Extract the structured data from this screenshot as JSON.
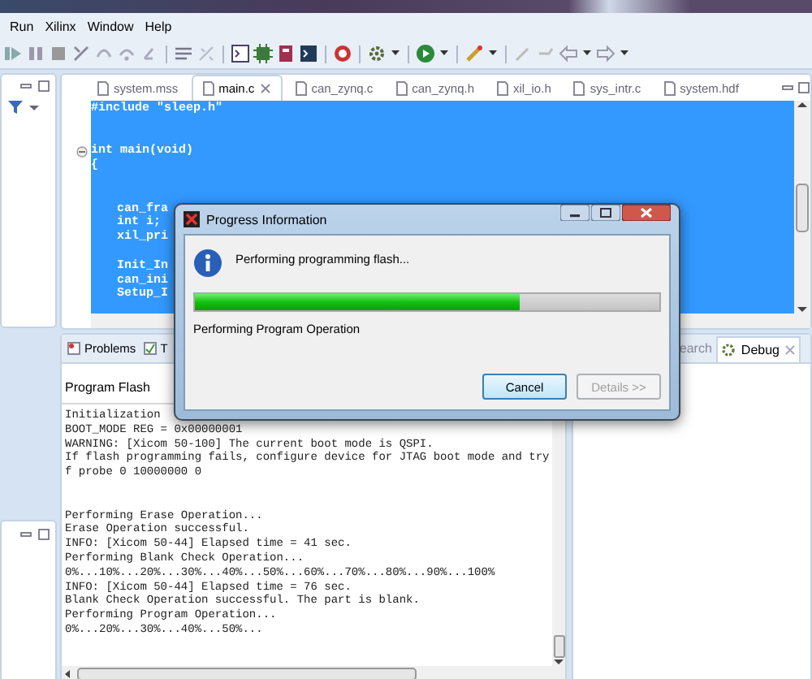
{
  "menu": [
    "Run",
    "Xilinx",
    "Window",
    "Help"
  ],
  "editor": {
    "tabs": [
      {
        "label": "system.mss",
        "selected": false
      },
      {
        "label": "main.c",
        "selected": true
      },
      {
        "label": "can_zynq.c",
        "selected": false
      },
      {
        "label": "can_zynq.h",
        "selected": false
      },
      {
        "label": "xil_io.h",
        "selected": false
      },
      {
        "label": "sys_intr.c",
        "selected": false
      },
      {
        "label": "system.hdf",
        "selected": false
      }
    ],
    "code_blocks": [
      {
        "lines": [
          "#include \"sleep.h\""
        ],
        "indented": false,
        "fold": false
      },
      {
        "lines": [
          "int main(void)",
          "{"
        ],
        "indented": false,
        "fold": true
      },
      {
        "lines": [
          "can_fra",
          "int i;",
          "xil_pri"
        ],
        "indented": true,
        "fold": false
      },
      {
        "lines": [
          "Init_In",
          "can_ini",
          "Setup_I"
        ],
        "indented": true,
        "fold": false
      }
    ]
  },
  "console": {
    "tabs": [
      {
        "label": "Problems",
        "selected": false
      },
      {
        "label": "T",
        "selected": false
      }
    ],
    "title": "Program Flash",
    "blocks": [
      [
        "Initialization",
        "BOOT_MODE REG = 0x00000001",
        "WARNING: [Xicom 50-100] The current boot mode is QSPI.",
        "If flash programming fails, configure device for JTAG boot mode and try",
        "f probe 0 10000000 0"
      ],
      [
        "Performing Erase Operation...",
        "Erase Operation successful.",
        "INFO: [Xicom 50-44] Elapsed time = 41 sec.",
        "Performing Blank Check Operation...",
        "0%...10%...20%...30%...40%...50%...60%...70%...80%...90%...100%",
        "INFO: [Xicom 50-44] Elapsed time = 76 sec.",
        "Blank Check Operation successful. The part is blank.",
        "Performing Program Operation...",
        "0%...20%...30%...40%...50%..."
      ]
    ]
  },
  "right_panel": {
    "tabs": [
      {
        "label": "earch",
        "selected": false
      },
      {
        "label": "Debug",
        "selected": true
      }
    ]
  },
  "dialog": {
    "title": "Progress Information",
    "message": "Performing programming flash...",
    "level": 0.7,
    "status": "Performing Program Operation",
    "buttons": [
      {
        "label": "Cancel",
        "disabled": false
      },
      {
        "label": "Details >>",
        "disabled": true
      }
    ]
  }
}
